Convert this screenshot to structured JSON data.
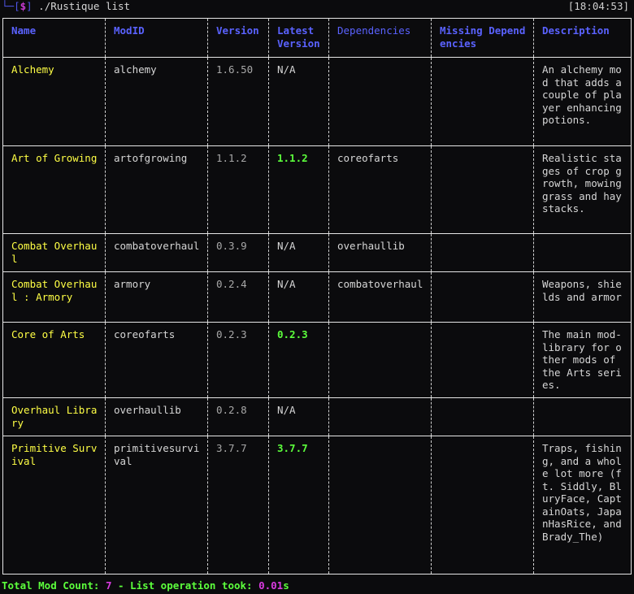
{
  "window": {
    "prompt_corner": "└─",
    "prompt_open": "[",
    "prompt_dollar": "$",
    "prompt_close": "]",
    "command": " ./Rustique list",
    "clock": "[18:04:53]"
  },
  "colors": {
    "header": "#5a62ff",
    "mod_name": "#ffff45",
    "newer_version": "#5cff3c",
    "prompt": "#4f55e6",
    "count": "#d93be0"
  },
  "table": {
    "headers": {
      "name": "Name",
      "modid": "ModID",
      "version": "Version",
      "latest": "Latest Version",
      "deps": "Dependencies",
      "missing": "Missing Dependencies",
      "desc": "Description"
    },
    "rows": [
      {
        "name": "Alchemy",
        "modid": "alchemy",
        "version": "1.6.50",
        "latest": "N/A",
        "deps": "",
        "missing": "",
        "desc": "An alchemy mod that adds a couple of player enhancing potions."
      },
      {
        "name": "Art of Growing",
        "modid": "artofgrowing",
        "version": "1.1.2",
        "latest": "1.1.2",
        "deps": "coreofarts",
        "missing": "",
        "desc": "Realistic stages of crop growth, mowing grass and haystacks."
      },
      {
        "name": "Combat Overhaul",
        "modid": "combatoverhaul",
        "version": "0.3.9",
        "latest": "N/A",
        "deps": "overhaullib",
        "missing": "",
        "desc": ""
      },
      {
        "name": "Combat Overhaul : Armory",
        "modid": "armory",
        "version": "0.2.4",
        "latest": "N/A",
        "deps": "combatoverhaul",
        "missing": "",
        "desc": "Weapons, shields and armor"
      },
      {
        "name": "Core of Arts",
        "modid": "coreofarts",
        "version": "0.2.3",
        "latest": "0.2.3",
        "deps": "",
        "missing": "",
        "desc": "The main mod-library for other mods of the Arts series."
      },
      {
        "name": "Overhaul Library",
        "modid": "overhaullib",
        "version": "0.2.8",
        "latest": "N/A",
        "deps": "",
        "missing": "",
        "desc": ""
      },
      {
        "name": "Primitive Survival",
        "modid": "primitivesurvival",
        "version": "3.7.7",
        "latest": "3.7.7",
        "deps": "",
        "missing": "",
        "desc": "Traps, fishing, and a whole lot more (ft. Siddly, BluryFace, CaptainOats, JapanHasRice, and Brady_The)"
      }
    ]
  },
  "footer": {
    "label": "Total Mod Count: ",
    "count": "7",
    "sep": " - List operation took: ",
    "time": "0.01",
    "unit": "s"
  }
}
